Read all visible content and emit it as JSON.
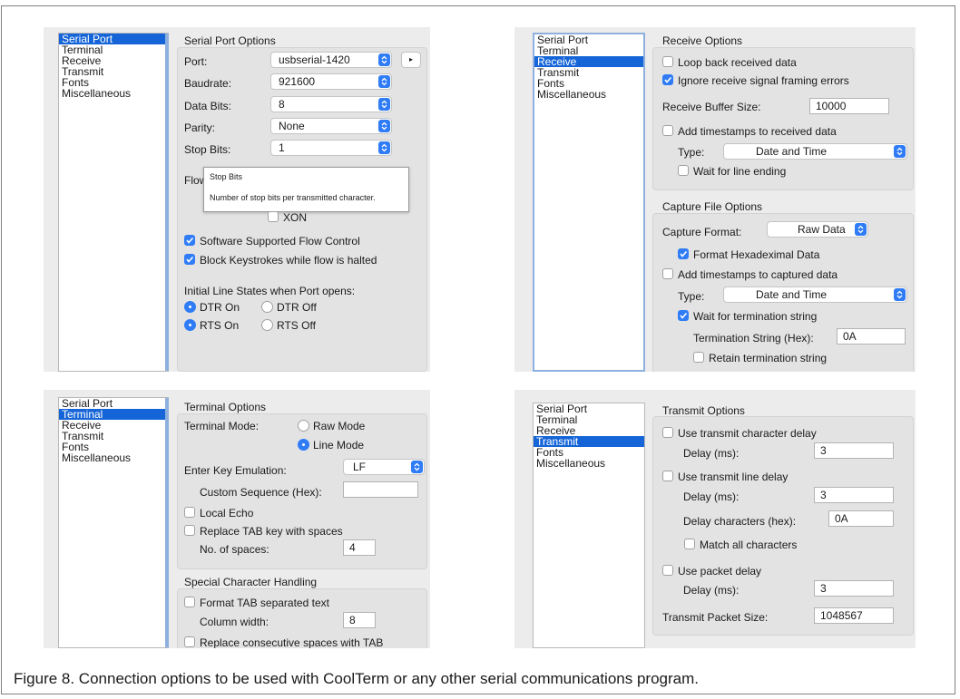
{
  "nav_items": [
    "Serial Port",
    "Terminal",
    "Receive",
    "Transmit",
    "Fonts",
    "Miscellaneous"
  ],
  "serial_port": {
    "title": "Serial Port Options",
    "port_label": "Port:",
    "port_value": "usbserial-1420",
    "port_more": "▸",
    "baudrate_label": "Baudrate:",
    "baudrate_value": "921600",
    "databits_label": "Data Bits:",
    "databits_value": "8",
    "parity_label": "Parity:",
    "parity_value": "None",
    "stopbits_label": "Stop Bits:",
    "stopbits_value": "1",
    "flow_label": "Flow",
    "tooltip_title": "Stop Bits",
    "tooltip_text": "Number of stop bits per transmitted character.",
    "xon_label": "XON",
    "sw_flow_label": "Software Supported Flow Control",
    "block_keys_label": "Block Keystrokes while flow is halted",
    "initial_states_label": "Initial Line States when Port opens:",
    "dtr_on": "DTR On",
    "dtr_off": "DTR Off",
    "rts_on": "RTS On",
    "rts_off": "RTS Off"
  },
  "receive": {
    "title": "Receive Options",
    "loopback_label": "Loop back received data",
    "ignore_errors_label": "Ignore receive signal framing errors",
    "buffer_label": "Receive Buffer Size:",
    "buffer_value": "10000",
    "timestamps_label": "Add timestamps to received data",
    "type_label": "Type:",
    "type_value": "Date and Time",
    "wait_line_label": "Wait for line ending",
    "capture_title": "Capture File Options",
    "format_label": "Capture Format:",
    "format_value": "Raw Data",
    "hex_label": "Format Hexadeximal Data",
    "cap_timestamps_label": "Add timestamps to captured data",
    "cap_type_label": "Type:",
    "cap_type_value": "Date and Time",
    "wait_term_label": "Wait for termination string",
    "term_label": "Termination String (Hex):",
    "term_value": "0A",
    "retain_label": "Retain termination string"
  },
  "terminal": {
    "title": "Terminal Options",
    "mode_label": "Terminal Mode:",
    "raw_mode": "Raw Mode",
    "line_mode": "Line Mode",
    "enter_label": "Enter Key Emulation:",
    "enter_value": "LF",
    "custom_label": "Custom Sequence (Hex):",
    "custom_value": "",
    "local_echo_label": "Local Echo",
    "replace_tab_label": "Replace TAB key with spaces",
    "spaces_label": "No. of spaces:",
    "spaces_value": "4",
    "special_title": "Special Character Handling",
    "format_tab_label": "Format TAB separated text",
    "col_width_label": "Column width:",
    "col_width_value": "8",
    "replace_spaces_label": "Replace consecutive spaces with TAB"
  },
  "transmit": {
    "title": "Transmit Options",
    "char_delay_label": "Use transmit character delay",
    "char_delay_ms_label": "Delay (ms):",
    "char_delay_ms_value": "3",
    "line_delay_label": "Use transmit line delay",
    "line_delay_ms_label": "Delay (ms):",
    "line_delay_ms_value": "3",
    "delay_chars_label": "Delay characters (hex):",
    "delay_chars_value": "0A",
    "match_all_label": "Match all characters",
    "packet_delay_label": "Use packet delay",
    "packet_delay_ms_label": "Delay (ms):",
    "packet_delay_ms_value": "3",
    "packet_size_label": "Transmit Packet Size:",
    "packet_size_value": "1048567"
  },
  "caption": "Figure 8. Connection options to be used with CoolTerm or any other serial communications program.",
  "colors": {
    "accent": "#2f7cf6",
    "selection": "#1565d8",
    "panel": "#ececec"
  }
}
